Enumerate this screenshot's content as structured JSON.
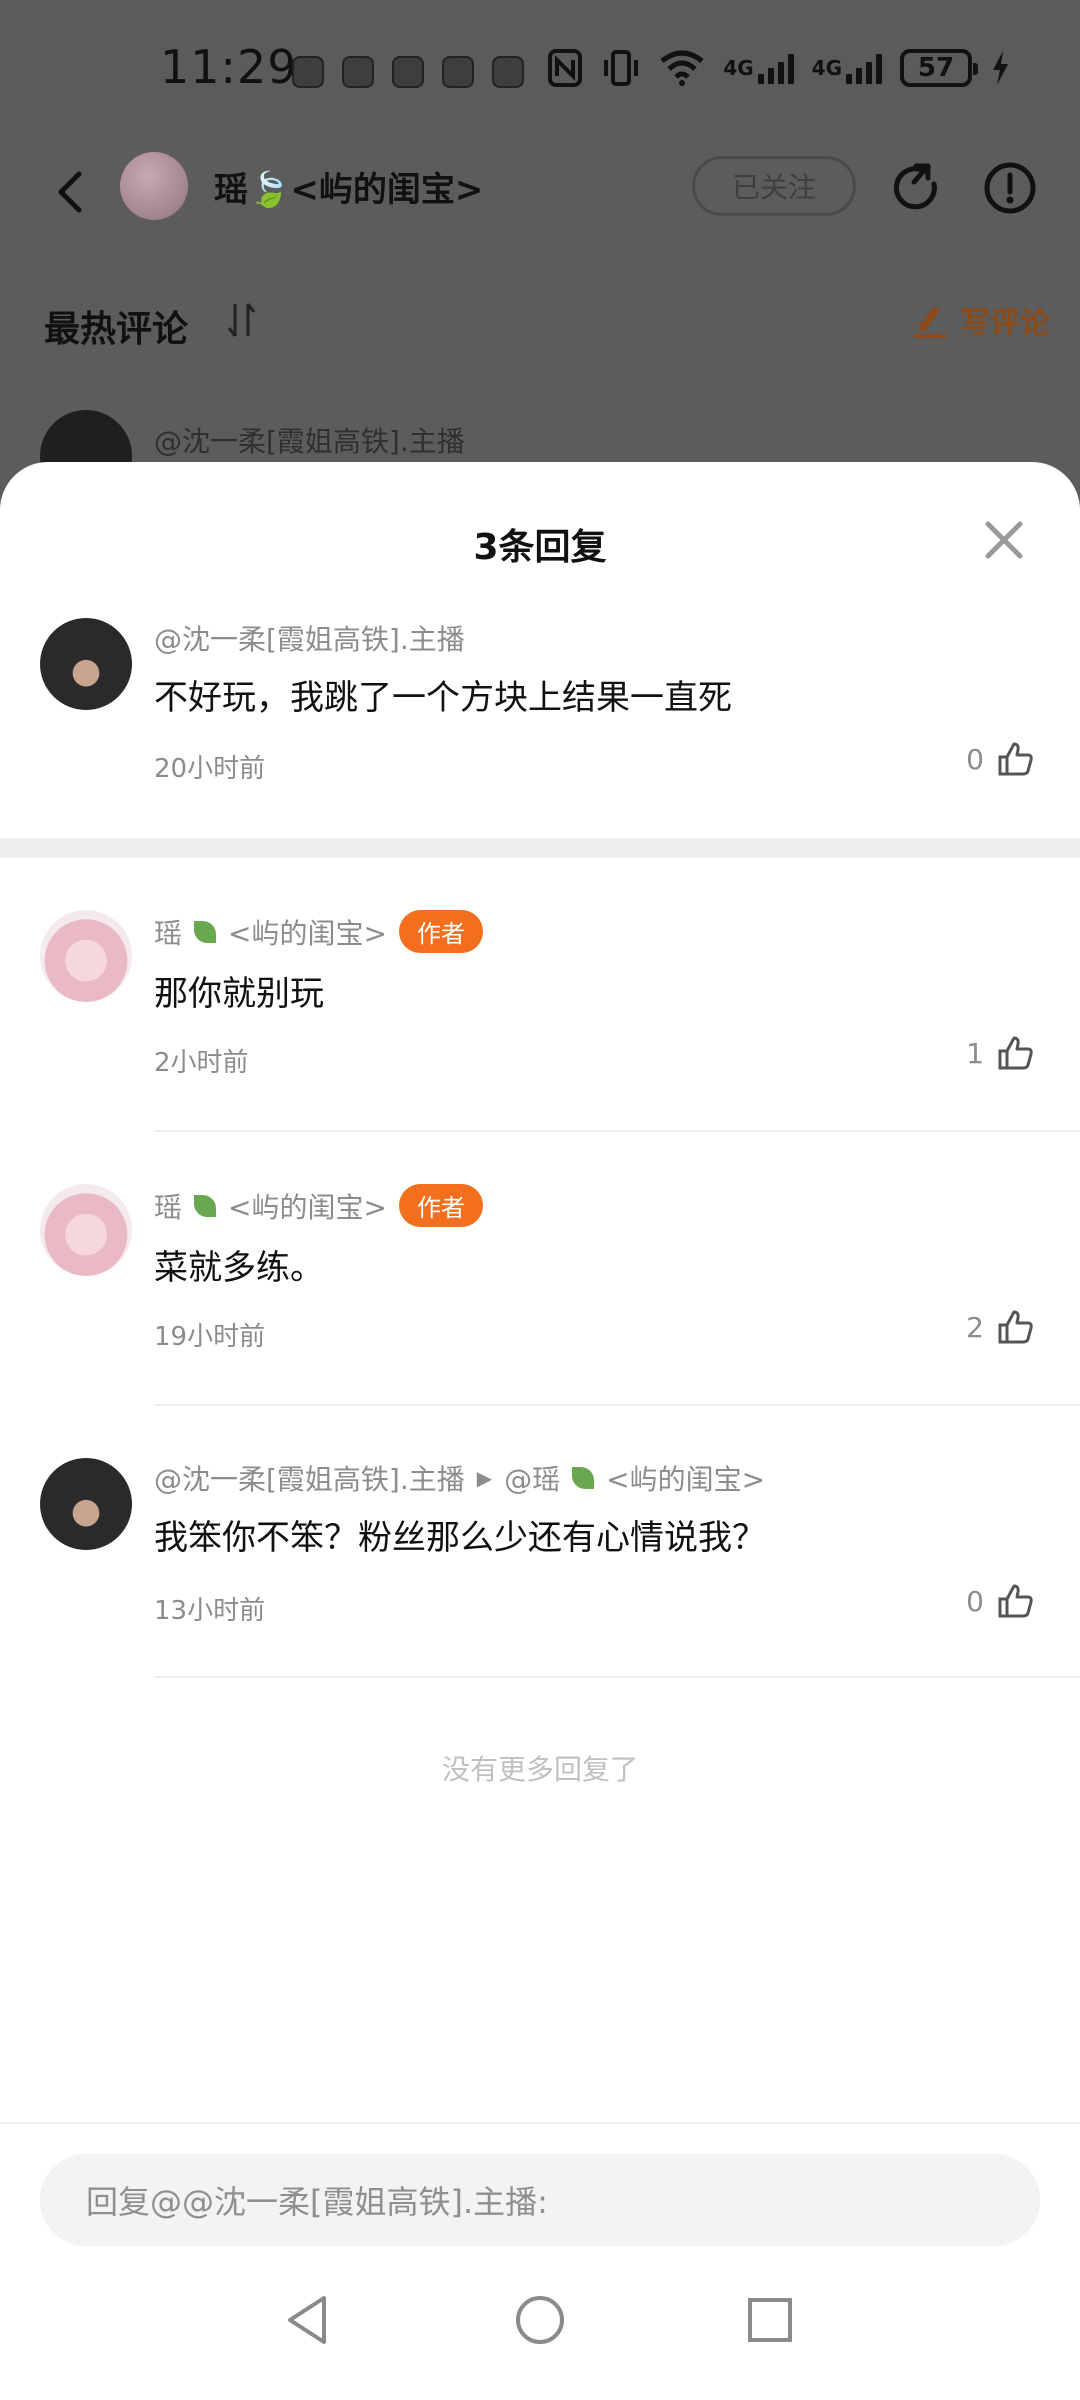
{
  "status_bar": {
    "time": "11:29",
    "net1": "4G",
    "net2": "4G",
    "battery": "57"
  },
  "header": {
    "title": "瑶🍃<屿的闺宝>",
    "follow_label": "已关注",
    "section_title": "最热评论",
    "write_comment": "写评论",
    "bg_comment_name": "@沈一柔[霞姐高铁].主播"
  },
  "sheet": {
    "title": "3条回复",
    "comments": [
      {
        "name": "@沈一柔[霞姐高铁].主播",
        "text": "不好玩，我跳了一个方块上结果一直死",
        "time": "20小时前",
        "likes": "0"
      },
      {
        "name": "瑶",
        "name_suffix": "<屿的闺宝>",
        "badge": "作者",
        "text": "那你就别玩",
        "time": "2小时前",
        "likes": "1"
      },
      {
        "name": "瑶",
        "name_suffix": "<屿的闺宝>",
        "badge": "作者",
        "text": "菜就多练。",
        "time": "19小时前",
        "likes": "2"
      },
      {
        "name": "@沈一柔[霞姐高铁].主播",
        "reply_to": "@瑶",
        "reply_to_suffix": "<屿的闺宝>",
        "text": "我笨你不笨？粉丝那么少还有心情说我？",
        "time": "13小时前",
        "likes": "0"
      }
    ],
    "no_more": "没有更多回复了",
    "reply_placeholder": "回复@@沈一柔[霞姐高铁].主播:"
  },
  "colors": {
    "accent": "#f36f1d",
    "muted": "#8c8c8c"
  }
}
